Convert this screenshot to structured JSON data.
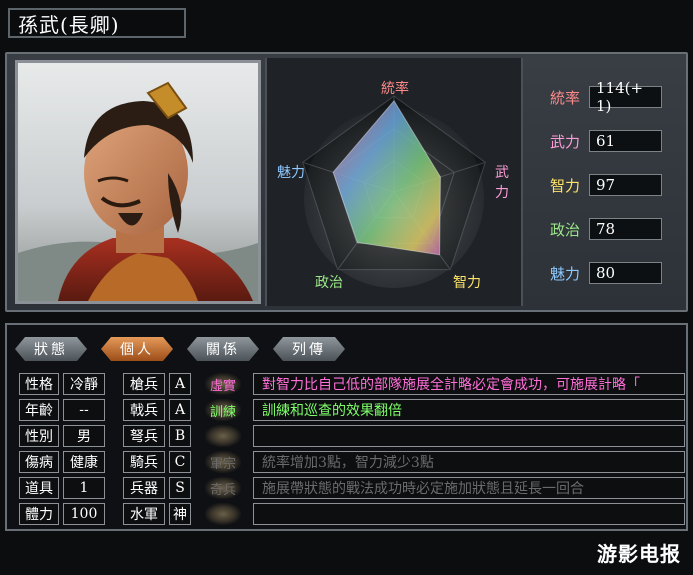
{
  "header": {
    "name": "孫武(長卿)"
  },
  "radar": {
    "labels": {
      "top": "統率",
      "right": "武力",
      "bottom_right": "智力",
      "bottom_left": "政治",
      "left": "魅力"
    },
    "values": {
      "統率": 114,
      "武力": 61,
      "智力": 97,
      "政治": 78,
      "魅力": 80
    }
  },
  "stats": [
    {
      "label": "統率",
      "value": "114(+ 1)",
      "color": "#ff8a8a"
    },
    {
      "label": "武力",
      "value": "61",
      "color": "#ff9bd8"
    },
    {
      "label": "智力",
      "value": "97",
      "color": "#ffe36a"
    },
    {
      "label": "政治",
      "value": "78",
      "color": "#9de88a"
    },
    {
      "label": "魅力",
      "value": "80",
      "color": "#8ec8ff"
    }
  ],
  "tabs": [
    {
      "label": "狀態",
      "active": false
    },
    {
      "label": "個人",
      "active": true
    },
    {
      "label": "關係",
      "active": false
    },
    {
      "label": "列傳",
      "active": false
    }
  ],
  "profile": [
    {
      "label": "性格",
      "value": "冷靜"
    },
    {
      "label": "年齡",
      "value": "--"
    },
    {
      "label": "性別",
      "value": "男"
    },
    {
      "label": "傷病",
      "value": "健康"
    },
    {
      "label": "道具",
      "value": "1"
    },
    {
      "label": "體力",
      "value": "100"
    }
  ],
  "aptitude": [
    {
      "label": "槍兵",
      "grade": "A"
    },
    {
      "label": "戟兵",
      "grade": "A"
    },
    {
      "label": "弩兵",
      "grade": "B"
    },
    {
      "label": "騎兵",
      "grade": "C"
    },
    {
      "label": "兵器",
      "grade": "S"
    },
    {
      "label": "水軍",
      "grade": "神"
    }
  ],
  "skills": [
    {
      "name": "虛實",
      "desc": "對智力比自己低的部隊施展全計略必定會成功，可施展計略「",
      "name_color": "#ff6fd8",
      "desc_color": "#ff6fd8"
    },
    {
      "name": "訓練",
      "desc": "訓練和巡查的效果翻倍",
      "name_color": "#7fff6a",
      "desc_color": "#7fff6a"
    },
    {
      "name": "",
      "desc": "",
      "name_color": "#888888",
      "desc_color": "#888888"
    },
    {
      "name": "軍宗",
      "desc": "統率增加3點，智力減少3點",
      "name_color": "#6b6b6b",
      "desc_color": "#6b6b6b"
    },
    {
      "name": "奇兵",
      "desc": "施展帶狀態的戰法成功時必定施加狀態且延長一回合",
      "name_color": "#6b6b6b",
      "desc_color": "#6b6b6b"
    },
    {
      "name": "",
      "desc": "",
      "name_color": "#888888",
      "desc_color": "#888888"
    }
  ],
  "watermark": "游影电报"
}
